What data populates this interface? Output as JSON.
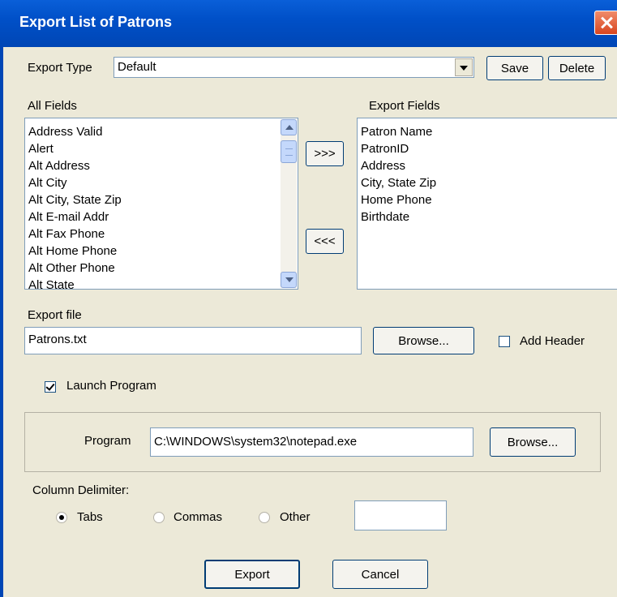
{
  "window": {
    "title": "Export List of Patrons"
  },
  "export_type": {
    "label": "Export Type",
    "value": "Default",
    "save_label": "Save",
    "delete_label": "Delete"
  },
  "all_fields": {
    "label": "All Fields",
    "items": [
      "Address Valid",
      "Alert",
      "Alt Address",
      "Alt City",
      "Alt City, State Zip",
      "Alt E-mail Addr",
      "Alt Fax Phone",
      "Alt Home Phone",
      "Alt Other Phone",
      "Alt State"
    ]
  },
  "transfer": {
    "add_label": ">>>",
    "remove_label": "<<<"
  },
  "export_fields": {
    "label": "Export Fields",
    "items": [
      "Patron Name",
      "PatronID",
      "Address",
      "City, State Zip",
      "Home Phone",
      "Birthdate"
    ]
  },
  "export_file": {
    "label": "Export file",
    "value": "Patrons.txt",
    "browse_label": "Browse...",
    "add_header_label": "Add Header",
    "add_header_checked": false
  },
  "launch": {
    "label": "Launch Program",
    "checked": true
  },
  "program": {
    "label": "Program",
    "value": "C:\\WINDOWS\\system32\\notepad.exe",
    "browse_label": "Browse..."
  },
  "delimiter": {
    "label": "Column Delimiter:",
    "options": [
      "Tabs",
      "Commas",
      "Other"
    ],
    "selected": "Tabs",
    "other_value": ""
  },
  "actions": {
    "export_label": "Export",
    "cancel_label": "Cancel"
  }
}
